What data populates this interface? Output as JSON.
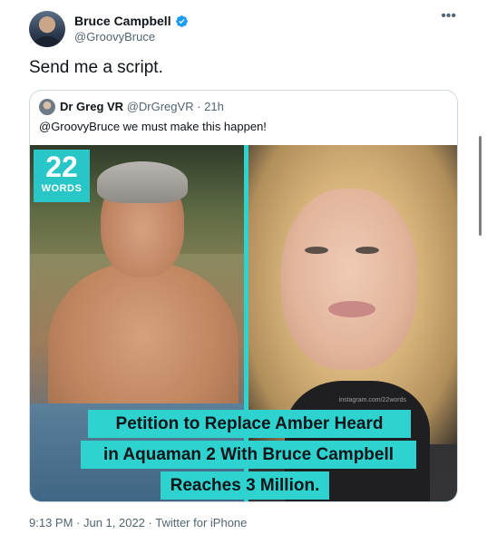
{
  "author": {
    "display_name": "Bruce Campbell",
    "handle": "@GroovyBruce",
    "verified_color": "#1d9bf0"
  },
  "more_icon": "•••",
  "tweet": {
    "text": "Send me a script.",
    "timestamp": "9:13 PM · Jun 1, 2022 · Twitter for iPhone"
  },
  "quote": {
    "display_name": "Dr Greg VR",
    "handle": "@DrGregVR",
    "time": "21h",
    "text": "@GroovyBruce we must make this happen!",
    "media": {
      "badge_number": "22",
      "badge_word": "WORDS",
      "watermark": "instagram.com/22words",
      "caption_lines": [
        "Petition to Replace Amber Heard",
        "in Aquaman 2 With Bruce Campbell",
        "Reaches 3 Million."
      ],
      "caption_bg": "#2ed3d0"
    }
  },
  "colors": {
    "text_primary": "#0f1419",
    "text_secondary": "#536471",
    "border": "#cfd9de"
  }
}
